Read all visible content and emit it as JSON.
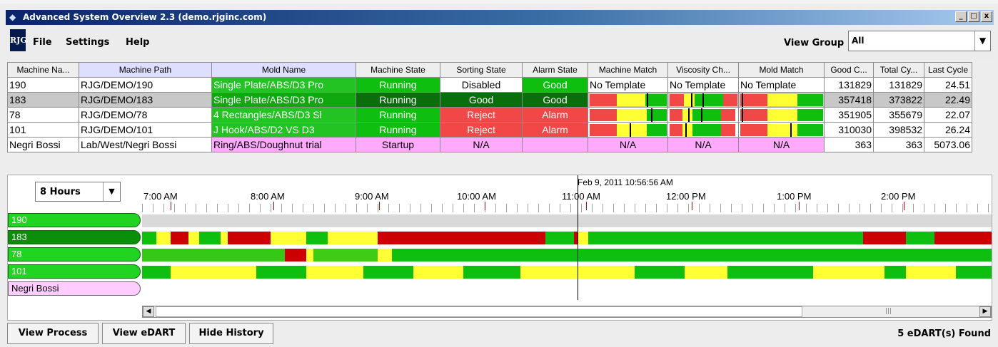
{
  "window": {
    "title": "Advanced System Overview 2.3 (demo.rjginc.com)",
    "logo_text": "RJG",
    "minimize": "_",
    "maximize": "□",
    "close": "x"
  },
  "menu": {
    "file": "File",
    "settings": "Settings",
    "help": "Help"
  },
  "view_group": {
    "label": "View Group",
    "value": "All"
  },
  "table": {
    "headers": [
      "Machine Na...",
      "Machine Path",
      "Mold Name",
      "Machine State",
      "Sorting State",
      "Alarm State",
      "Machine Match",
      "Viscosity Ch...",
      "Mold Match",
      "Good C...",
      "Total Cy...",
      "Last Cycle"
    ],
    "rows": [
      {
        "machine": "190",
        "path": "RJG/DEMO/190",
        "mold": "Single Plate/ABS/D3 Pro",
        "machine_state": "Running",
        "sorting_state": "Disabled",
        "alarm_state": "Good",
        "machine_match": "No Template",
        "viscosity": "No Template",
        "mold_match": "No Template",
        "good": "131829",
        "total": "131829",
        "last": "24.51"
      },
      {
        "machine": "183",
        "path": "RJG/DEMO/183",
        "mold": "Single Plate/ABS/D3 Pro",
        "machine_state": "Running",
        "sorting_state": "Good",
        "alarm_state": "Good",
        "machine_match": "",
        "viscosity": "",
        "mold_match": "",
        "good": "357418",
        "total": "373822",
        "last": "22.49"
      },
      {
        "machine": "78",
        "path": "RJG/DEMO/78",
        "mold": "4 Rectangles/ABS/D3 Sl",
        "machine_state": "Running",
        "sorting_state": "Reject",
        "alarm_state": "Alarm",
        "machine_match": "",
        "viscosity": "",
        "mold_match": "",
        "good": "351905",
        "total": "355679",
        "last": "22.07"
      },
      {
        "machine": "101",
        "path": "RJG/DEMO/101",
        "mold": "J Hook/ABS/D2 VS D3",
        "machine_state": "Running",
        "sorting_state": "Reject",
        "alarm_state": "Alarm",
        "machine_match": "",
        "viscosity": "",
        "mold_match": "",
        "good": "310030",
        "total": "398532",
        "last": "26.24"
      },
      {
        "machine": "Negri Bossi",
        "path": "Lab/West/Negri Bossi",
        "mold": "Ring/ABS/Doughnut trial",
        "machine_state": "Startup",
        "sorting_state": "N/A",
        "alarm_state": "",
        "machine_match": "N/A",
        "viscosity": "N/A",
        "mold_match": "N/A",
        "good": "363",
        "total": "363",
        "last": "5073.06"
      }
    ]
  },
  "history": {
    "range": "8 Hours",
    "cursor_time": "Feb 9, 2011 10:56:56 AM",
    "time_labels": [
      "7:00 AM",
      "8:00 AM",
      "9:00 AM",
      "10:00 AM",
      "11:00 AM",
      "12:00 PM",
      "1:00 PM",
      "2:00 PM"
    ],
    "machines": [
      "190",
      "183",
      "78",
      "101",
      "Negri Bossi"
    ]
  },
  "buttons": {
    "view_process": "View Process",
    "view_edart": "View eDART",
    "hide_history": "Hide History"
  },
  "status": "5 eDART(s) Found",
  "colors": {
    "green": "#0fbf0f",
    "red": "#f24747",
    "yellow": "#ffff33",
    "darkred": "#cc0000",
    "pink": "#ffaaff"
  }
}
